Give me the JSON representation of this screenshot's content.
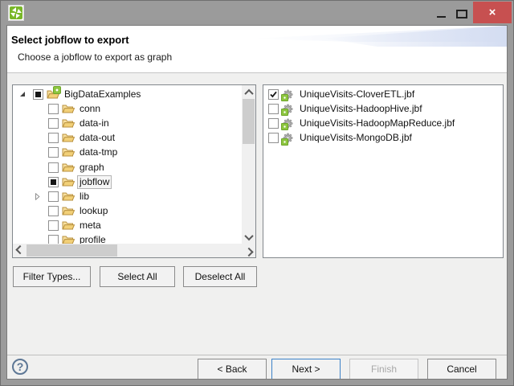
{
  "colors": {
    "titlebar_gray": "#9b9b9b",
    "close_button_red": "#c75050",
    "clover_green": "#79b729",
    "focus_border_blue": "#3c82c8"
  },
  "window": {
    "controls": {
      "close_glyph": "×"
    }
  },
  "header": {
    "title": "Select jobflow to export",
    "subtitle": "Choose a jobflow to export as graph"
  },
  "tree": {
    "items": [
      {
        "label": "BigDataExamples",
        "type": "project",
        "check": "partial",
        "expand": "expanded"
      },
      {
        "label": "conn",
        "type": "folder",
        "check": "none"
      },
      {
        "label": "data-in",
        "type": "folder",
        "check": "none"
      },
      {
        "label": "data-out",
        "type": "folder",
        "check": "none"
      },
      {
        "label": "data-tmp",
        "type": "folder",
        "check": "none"
      },
      {
        "label": "graph",
        "type": "folder",
        "check": "none"
      },
      {
        "label": "jobflow",
        "type": "folder",
        "check": "partial",
        "selected": true
      },
      {
        "label": "lib",
        "type": "folder",
        "check": "none",
        "expand": "collapsed"
      },
      {
        "label": "lookup",
        "type": "folder",
        "check": "none"
      },
      {
        "label": "meta",
        "type": "folder",
        "check": "none"
      },
      {
        "label": "profile",
        "type": "folder",
        "check": "none"
      }
    ]
  },
  "files": {
    "items": [
      {
        "label": "UniqueVisits-CloverETL.jbf",
        "checked": true
      },
      {
        "label": "UniqueVisits-HadoopHive.jbf",
        "checked": false
      },
      {
        "label": "UniqueVisits-HadoopMapReduce.jbf",
        "checked": false
      },
      {
        "label": "UniqueVisits-MongoDB.jbf",
        "checked": false
      }
    ]
  },
  "actions": {
    "filter_types": "Filter Types...",
    "select_all": "Select All",
    "deselect_all": "Deselect All"
  },
  "footer": {
    "help_glyph": "?",
    "back": "< Back",
    "next": "Next >",
    "finish": "Finish",
    "cancel": "Cancel"
  }
}
